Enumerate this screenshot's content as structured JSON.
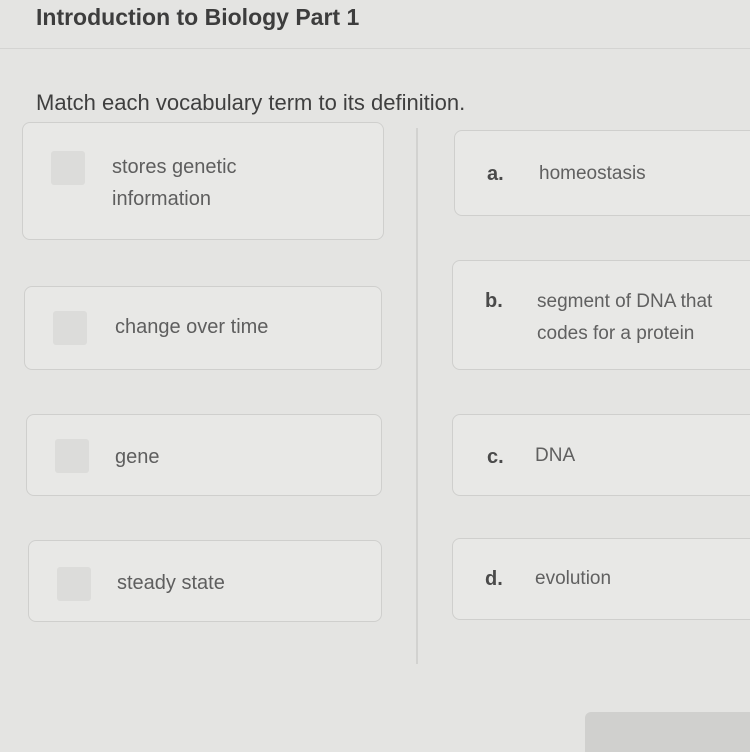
{
  "header": {
    "title": "Introduction to Biology Part 1"
  },
  "instructions": "Match each vocabulary term to its definition.",
  "terms": [
    {
      "line1": "stores genetic",
      "line2": "information"
    },
    {
      "line1": "change over time",
      "line2": ""
    },
    {
      "line1": "gene",
      "line2": ""
    },
    {
      "line1": "steady state",
      "line2": ""
    }
  ],
  "definitions": [
    {
      "letter": "a.",
      "line1": "homeostasis",
      "line2": ""
    },
    {
      "letter": "b.",
      "line1": "segment of DNA that",
      "line2": "codes for a protein"
    },
    {
      "letter": "c.",
      "line1": "DNA",
      "line2": ""
    },
    {
      "letter": "d.",
      "line1": "evolution",
      "line2": ""
    }
  ]
}
